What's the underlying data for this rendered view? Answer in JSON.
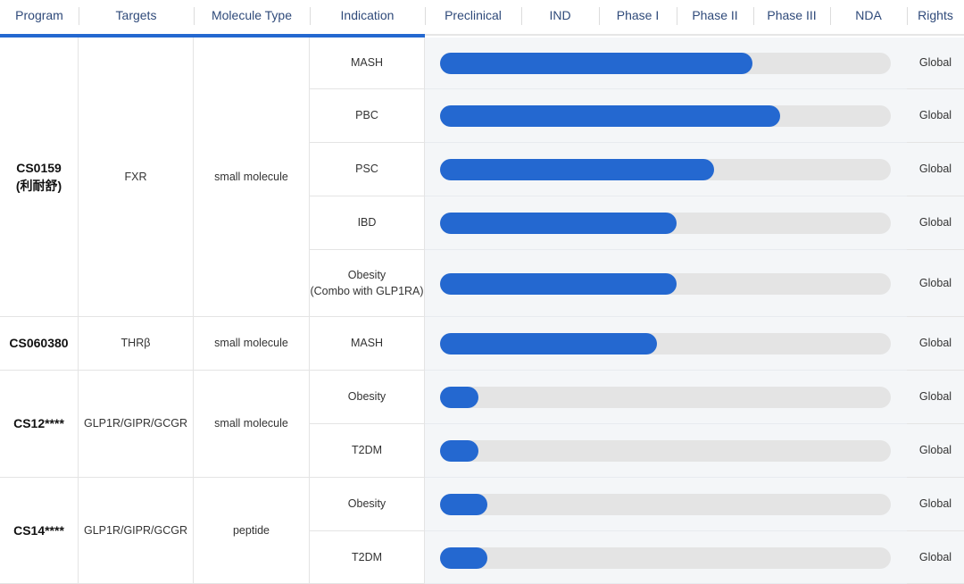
{
  "header": {
    "columns": [
      "Program",
      "Targets",
      "Molecule Type",
      "Indication",
      "Preclinical",
      "IND",
      "Phase I",
      "Phase II",
      "Phase III",
      "NDA",
      "Rights"
    ]
  },
  "colors": {
    "accent": "#2468d0",
    "track": "#e4e4e4"
  },
  "programs": [
    {
      "name": "CS0159",
      "name_cn": "(利耐舒)",
      "target": "FXR",
      "molecule_type": "small molecule",
      "indications": [
        {
          "label": "MASH",
          "sublabel": "",
          "progress": 0.693,
          "rights": "Global"
        },
        {
          "label": "PBC",
          "sublabel": "",
          "progress": 0.754,
          "rights": "Global"
        },
        {
          "label": "PSC",
          "sublabel": "",
          "progress": 0.608,
          "rights": "Global"
        },
        {
          "label": "IBD",
          "sublabel": "",
          "progress": 0.525,
          "rights": "Global"
        },
        {
          "label": "Obesity",
          "sublabel": "(Combo with GLP1RA)",
          "progress": 0.525,
          "rights": "Global"
        }
      ]
    },
    {
      "name": "CS060380",
      "name_cn": "",
      "target": "THRβ",
      "molecule_type": "small molecule",
      "indications": [
        {
          "label": "MASH",
          "sublabel": "",
          "progress": 0.481,
          "rights": "Global"
        }
      ]
    },
    {
      "name": "CS12****",
      "name_cn": "",
      "target": "GLP1R/GIPR/GCGR",
      "molecule_type": "small molecule",
      "indications": [
        {
          "label": "Obesity",
          "sublabel": "",
          "progress": 0.085,
          "rights": "Global"
        },
        {
          "label": "T2DM",
          "sublabel": "",
          "progress": 0.085,
          "rights": "Global"
        }
      ]
    },
    {
      "name": "CS14****",
      "name_cn": "",
      "target": "GLP1R/GIPR/GCGR",
      "molecule_type": "peptide",
      "indications": [
        {
          "label": "Obesity",
          "sublabel": "",
          "progress": 0.105,
          "rights": "Global"
        },
        {
          "label": "T2DM",
          "sublabel": "",
          "progress": 0.105,
          "rights": "Global"
        }
      ]
    }
  ]
}
